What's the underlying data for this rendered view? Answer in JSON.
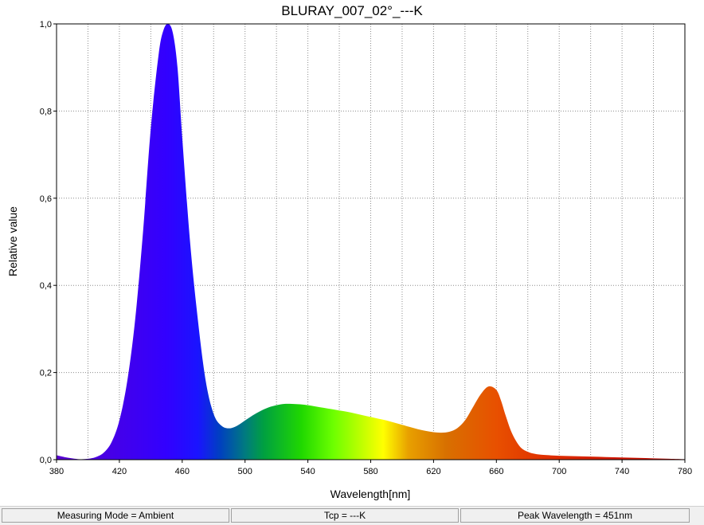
{
  "chart_data": {
    "type": "area",
    "title": "BLURAY_007_02°_---K",
    "xlabel": "Wavelength[nm]",
    "ylabel": "Relative value",
    "xlim": [
      380,
      780
    ],
    "ylim": [
      0,
      1.0
    ],
    "x_ticks": [
      "380",
      "420",
      "460",
      "500",
      "540",
      "580",
      "620",
      "660",
      "700",
      "740",
      "780"
    ],
    "y_ticks": [
      "0,0",
      "0,2",
      "0,4",
      "0,6",
      "0,8",
      "1,0"
    ],
    "grid": true,
    "fill": "visible-spectrum-gradient",
    "x": [
      380,
      385,
      390,
      395,
      400,
      405,
      410,
      415,
      420,
      425,
      430,
      435,
      440,
      445,
      448,
      451,
      454,
      457,
      460,
      465,
      470,
      475,
      480,
      485,
      490,
      495,
      500,
      505,
      510,
      515,
      520,
      525,
      530,
      535,
      540,
      545,
      550,
      555,
      560,
      565,
      570,
      575,
      580,
      585,
      590,
      595,
      600,
      605,
      610,
      615,
      620,
      625,
      630,
      635,
      640,
      645,
      650,
      655,
      660,
      663,
      666,
      670,
      675,
      680,
      685,
      690,
      700,
      710,
      720,
      730,
      740,
      750,
      760,
      770,
      780
    ],
    "y": [
      0.01,
      0.006,
      0.003,
      0.001,
      0.002,
      0.006,
      0.016,
      0.04,
      0.09,
      0.18,
      0.32,
      0.52,
      0.76,
      0.93,
      0.985,
      1.0,
      0.98,
      0.9,
      0.74,
      0.5,
      0.32,
      0.18,
      0.105,
      0.078,
      0.072,
      0.078,
      0.09,
      0.102,
      0.112,
      0.12,
      0.125,
      0.128,
      0.128,
      0.127,
      0.125,
      0.122,
      0.119,
      0.116,
      0.113,
      0.11,
      0.106,
      0.102,
      0.098,
      0.094,
      0.09,
      0.085,
      0.08,
      0.075,
      0.07,
      0.066,
      0.063,
      0.062,
      0.064,
      0.072,
      0.09,
      0.12,
      0.15,
      0.168,
      0.16,
      0.135,
      0.1,
      0.06,
      0.03,
      0.018,
      0.013,
      0.011,
      0.009,
      0.008,
      0.007,
      0.006,
      0.005,
      0.004,
      0.003,
      0.002,
      0.001
    ]
  },
  "status_bar": {
    "mode": "Measuring Mode = Ambient",
    "tcp": "Tcp = ---K",
    "peak": "Peak Wavelength = 451nm"
  }
}
